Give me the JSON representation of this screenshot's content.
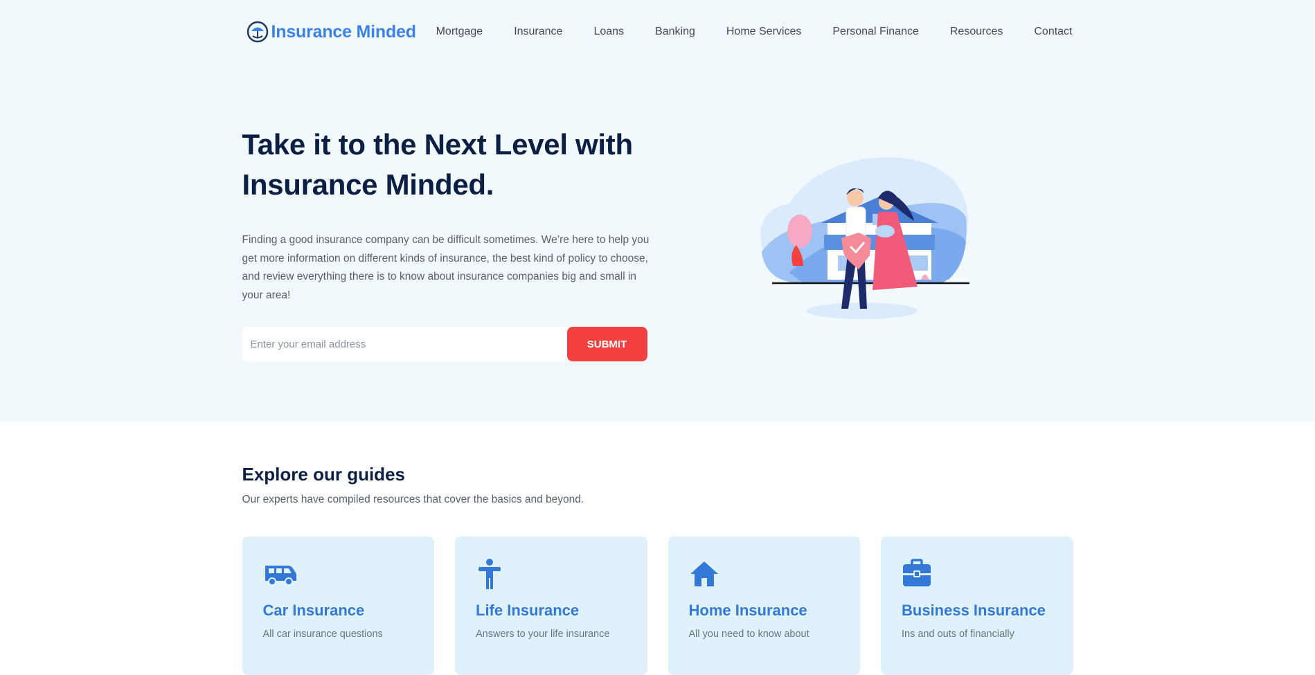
{
  "brand": {
    "name": "Insurance Minded",
    "color": "#3b82e6"
  },
  "nav": {
    "items": [
      "Mortgage",
      "Insurance",
      "Loans",
      "Banking",
      "Home Services",
      "Personal Finance",
      "Resources",
      "Contact"
    ]
  },
  "hero": {
    "title": "Take it to the Next Level with Insurance Minded.",
    "text": "Finding a good insurance company can be difficult sometimes. We’re here to help you get more information on different kinds of insurance, the best kind of policy to choose, and review everything there is to know about insurance companies big and small in your area!",
    "email_placeholder": "Enter your email address",
    "submit_label": "SUBMIT",
    "accent": "#f2413f"
  },
  "guides": {
    "title": "Explore our guides",
    "subtitle": "Our experts have compiled resources that cover the basics and beyond.",
    "cards": [
      {
        "icon": "van-icon",
        "title": "Car Insurance",
        "text": "All car insurance questions"
      },
      {
        "icon": "person-icon",
        "title": "Life Insurance",
        "text": "Answers to your life insurance"
      },
      {
        "icon": "house-icon",
        "title": "Home Insurance",
        "text": "All you need to know about"
      },
      {
        "icon": "briefcase-icon",
        "title": "Business Insurance",
        "text": "Ins and outs of financially"
      }
    ]
  }
}
